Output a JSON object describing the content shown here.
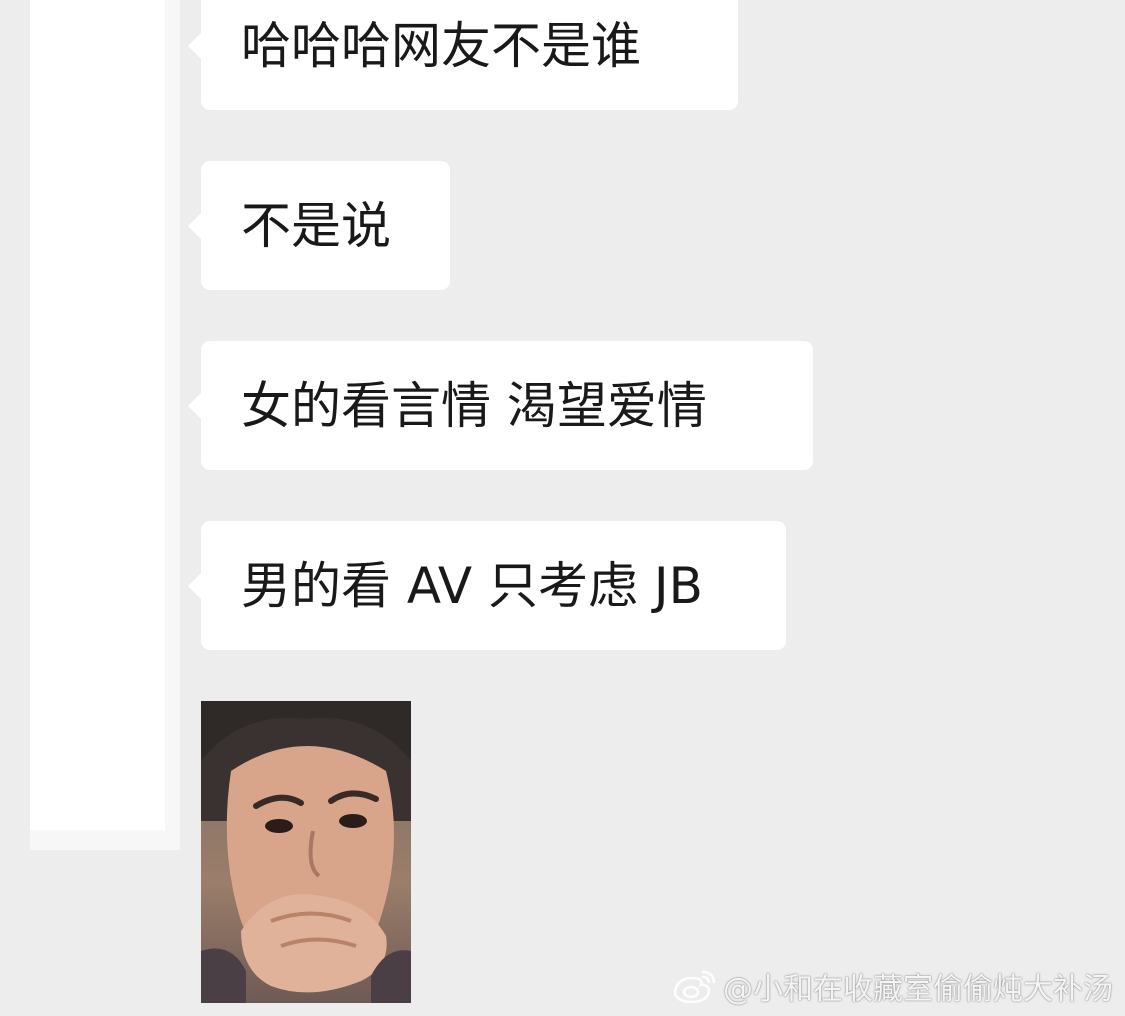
{
  "chat": {
    "messages": [
      {
        "text": "哈哈哈网友不是谁"
      },
      {
        "text": "不是说"
      },
      {
        "text": "女的看言情 渴望爱情"
      },
      {
        "text": "男的看 AV 只考虑 JB"
      }
    ],
    "sticker_icon": "reaction-meme-thinking"
  },
  "watermark": {
    "icon": "weibo-icon",
    "text": "@小和在收藏室偷偷炖大补汤"
  },
  "colors": {
    "background": "#ededed",
    "bubble": "#ffffff",
    "text": "#191919"
  }
}
